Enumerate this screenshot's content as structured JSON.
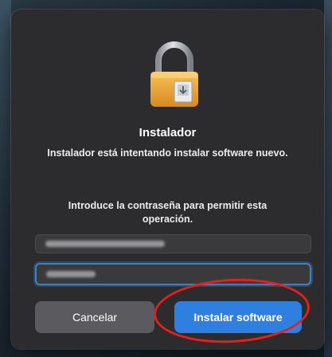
{
  "dialog": {
    "icon": "lock-icon",
    "title": "Instalador",
    "message": "Instalador está intentando instalar software nuevo.",
    "prompt": "Introduce la contraseña para permitir esta operación.",
    "username_field": {
      "state": "blurred value"
    },
    "password_field": {
      "state": "masked, focused"
    },
    "cancel_label": "Cancelar",
    "install_label": "Instalar software"
  },
  "annotation": {
    "type": "red-ellipse-highlight",
    "color": "#e3201b",
    "target": "install-software-button"
  },
  "colors": {
    "accent": "#2f7fe0",
    "dialog_bg": "#2c2c2e",
    "focus_ring": "#3f7fc4"
  }
}
